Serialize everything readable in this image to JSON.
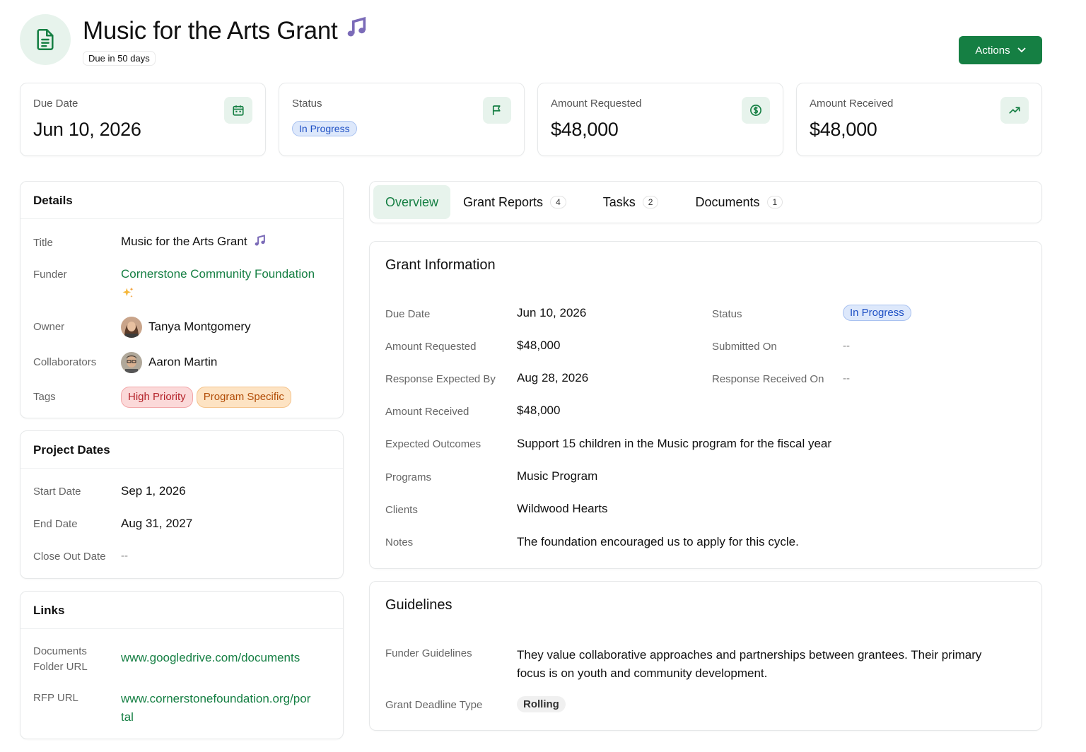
{
  "header": {
    "title": "Music for the Arts Grant",
    "title_icon": "music-note-icon",
    "due_badge": "Due in 50 days",
    "actions_label": "Actions"
  },
  "stats": [
    {
      "label": "Due Date",
      "value": "Jun 10, 2026",
      "icon": "calendar-icon"
    },
    {
      "label": "Status",
      "value": "In Progress",
      "icon": "flag-icon"
    },
    {
      "label": "Amount Requested",
      "value": "$48,000",
      "icon": "dollar-circle-icon"
    },
    {
      "label": "Amount Received",
      "value": "$48,000",
      "icon": "trending-up-icon"
    }
  ],
  "details": {
    "heading": "Details",
    "title_label": "Title",
    "title_value": "Music for the Arts Grant",
    "funder_label": "Funder",
    "funder_value": "Cornerstone Community Foundation",
    "owner_label": "Owner",
    "owner_value": "Tanya Montgomery",
    "collaborators_label": "Collaborators",
    "collaborators_value": "Aaron Martin",
    "tags_label": "Tags",
    "tags": [
      "High Priority",
      "Program Specific"
    ]
  },
  "project_dates": {
    "heading": "Project Dates",
    "start_label": "Start Date",
    "start_value": "Sep 1, 2026",
    "end_label": "End Date",
    "end_value": "Aug 31, 2027",
    "close_label": "Close Out Date",
    "close_value": "--"
  },
  "links": {
    "heading": "Links",
    "docs_label_1": "Documents",
    "docs_label_2": "Folder URL",
    "docs_value": "www.googledrive.com/documents",
    "rfp_label": "RFP URL",
    "rfp_value_1": "www.cornerstonefoundation.org/por",
    "rfp_value_2": "tal"
  },
  "tabs": [
    {
      "label": "Overview",
      "count": ""
    },
    {
      "label": "Grant Reports",
      "count": "4"
    },
    {
      "label": "Tasks",
      "count": "2"
    },
    {
      "label": "Documents",
      "count": "1"
    }
  ],
  "grant_info": {
    "heading": "Grant Information",
    "due_date_label": "Due Date",
    "due_date_value": "Jun 10, 2026",
    "status_label": "Status",
    "status_value": "In Progress",
    "amount_requested_label": "Amount Requested",
    "amount_requested_value": "$48,000",
    "submitted_on_label": "Submitted On",
    "submitted_on_value": "--",
    "response_expected_label": "Response Expected By",
    "response_expected_value": "Aug 28, 2026",
    "response_received_label": "Response Received On",
    "response_received_value": "--",
    "amount_received_label": "Amount Received",
    "amount_received_value": "$48,000",
    "outcomes_label": "Expected Outcomes",
    "outcomes_value": "Support 15 children in the Music program for the fiscal year",
    "programs_label": "Programs",
    "programs_value": "Music Program",
    "clients_label": "Clients",
    "clients_value": "Wildwood Hearts",
    "notes_label": "Notes",
    "notes_value": "The foundation encouraged us to apply for this cycle."
  },
  "guidelines": {
    "heading": "Guidelines",
    "funder_guidelines_label": "Funder Guidelines",
    "funder_guidelines_line1": "They value collaborative approaches and partnerships between grantees. Their primary",
    "funder_guidelines_line2": "focus is on youth and community development.",
    "deadline_type_label": "Grant Deadline Type",
    "deadline_type_value": "Rolling"
  },
  "colors": {
    "accent_green": "#157f43",
    "icon_bg": "#e7f3ec",
    "status_blue": "#1d4fc4"
  }
}
